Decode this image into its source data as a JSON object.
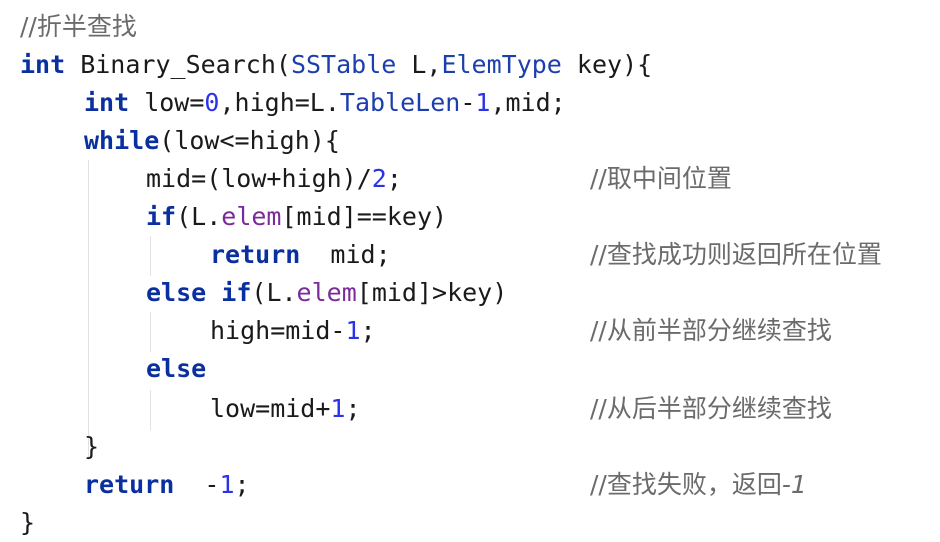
{
  "editor": {
    "code_lines": [
      {
        "id": "line-1",
        "tokens": [
          {
            "t": "//折半查找",
            "c": "cmt"
          }
        ]
      },
      {
        "id": "line-2",
        "tokens": [
          {
            "t": "int",
            "c": "kw"
          },
          {
            "t": " Binary_Search(",
            "c": ""
          },
          {
            "t": "SSTable",
            "c": "typ"
          },
          {
            "t": " L,",
            "c": ""
          },
          {
            "t": "ElemType",
            "c": "typ"
          },
          {
            "t": " key){",
            "c": ""
          }
        ]
      },
      {
        "id": "line-3",
        "tokens": [
          {
            "t": "int",
            "c": "kw"
          },
          {
            "t": " low=",
            "c": ""
          },
          {
            "t": "0",
            "c": "num"
          },
          {
            "t": ",high=L.",
            "c": ""
          },
          {
            "t": "TableLen",
            "c": "typ"
          },
          {
            "t": "-",
            "c": ""
          },
          {
            "t": "1",
            "c": "num"
          },
          {
            "t": ",mid;",
            "c": ""
          }
        ]
      },
      {
        "id": "line-4",
        "tokens": [
          {
            "t": "while",
            "c": "kw"
          },
          {
            "t": "(low<=high){",
            "c": ""
          }
        ]
      },
      {
        "id": "line-5",
        "tokens": [
          {
            "t": "mid=(low+high)/",
            "c": ""
          },
          {
            "t": "2",
            "c": "num"
          },
          {
            "t": ";",
            "c": ""
          }
        ]
      },
      {
        "id": "line-6",
        "tokens": [
          {
            "t": "if",
            "c": "kw"
          },
          {
            "t": "(L.",
            "c": ""
          },
          {
            "t": "elem",
            "c": "fld"
          },
          {
            "t": "[mid]==key)",
            "c": ""
          }
        ]
      },
      {
        "id": "line-7",
        "tokens": [
          {
            "t": "return",
            "c": "kw"
          },
          {
            "t": "  mid;",
            "c": ""
          }
        ]
      },
      {
        "id": "line-8",
        "tokens": [
          {
            "t": "else",
            "c": "kw"
          },
          {
            "t": " ",
            "c": ""
          },
          {
            "t": "if",
            "c": "kw"
          },
          {
            "t": "(L.",
            "c": ""
          },
          {
            "t": "elem",
            "c": "fld"
          },
          {
            "t": "[mid]>key)",
            "c": ""
          }
        ]
      },
      {
        "id": "line-9",
        "tokens": [
          {
            "t": "high=mid-",
            "c": ""
          },
          {
            "t": "1",
            "c": "num"
          },
          {
            "t": ";",
            "c": ""
          }
        ]
      },
      {
        "id": "line-10",
        "tokens": [
          {
            "t": "else",
            "c": "kw"
          }
        ]
      },
      {
        "id": "line-11",
        "tokens": [
          {
            "t": "low=mid+",
            "c": ""
          },
          {
            "t": "1",
            "c": "num"
          },
          {
            "t": ";",
            "c": ""
          }
        ]
      },
      {
        "id": "line-12",
        "tokens": [
          {
            "t": "}",
            "c": ""
          }
        ]
      },
      {
        "id": "line-13",
        "tokens": [
          {
            "t": "return",
            "c": "kw"
          },
          {
            "t": "  -",
            "c": ""
          },
          {
            "t": "1",
            "c": "num"
          },
          {
            "t": ";",
            "c": ""
          }
        ]
      },
      {
        "id": "line-14",
        "tokens": [
          {
            "t": "}",
            "c": ""
          }
        ]
      }
    ],
    "comments": {
      "line-5": "//取中间位置",
      "line-7": "//查找成功则返回所在位置",
      "line-9": "//从前半部分继续查找",
      "line-11": "//从后半部分继续查找",
      "line-13": "//查找失败，返回",
      "line-13-tail": "-1"
    }
  }
}
